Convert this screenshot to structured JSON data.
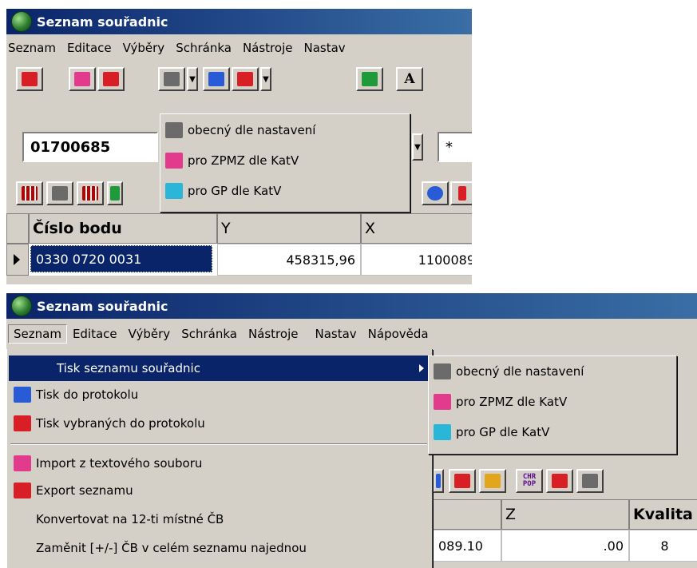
{
  "top": {
    "title": "Seznam souřadnic",
    "menu": [
      "Seznam",
      "Editace",
      "Výběry",
      "Schránka",
      "Nástroje",
      "Nastav"
    ],
    "point_field": "01700685",
    "filter_field": "*",
    "print_submenu": [
      "obecný dle nastavení",
      "pro ZPMZ dle KatV",
      "pro GP dle KatV"
    ],
    "toolbar_letter": "A",
    "grid": {
      "headers": [
        "Číslo bodu",
        "Y",
        "X"
      ],
      "row": {
        "cislo": "0330 0720 0031",
        "y": "458315,96",
        "x": "1100089"
      }
    }
  },
  "bottom": {
    "title": "Seznam souřadnic",
    "menu": [
      "Seznam",
      "Editace",
      "Výběry",
      "Schránka",
      "Nástroje",
      "Nastav",
      "Nápověda"
    ],
    "seznam_menu": [
      {
        "label": "Tisk seznamu souřadnic",
        "icon": "",
        "submenu": true
      },
      {
        "label": "Tisk do protokolu",
        "icon": "print-protocol-icon"
      },
      {
        "label": "Tisk vybraných do protokolu",
        "icon": "print-selected-icon"
      },
      {
        "label": "Import z textového souboru",
        "icon": "import-icon"
      },
      {
        "label": "Export seznamu",
        "icon": "export-icon"
      },
      {
        "label": "Konvertovat na 12-ti místné ČB",
        "icon": ""
      },
      {
        "label": "Zaměnit [+/-] ČB v celém seznamu najednou",
        "icon": ""
      }
    ],
    "print_submenu": [
      "obecný dle nastavení",
      "pro ZPMZ dle KatV",
      "pro GP dle KatV"
    ],
    "toolbar_chr": "CHR\nPOP",
    "grid": {
      "headers": [
        "Z",
        "Kvalita"
      ],
      "row": {
        "x_partial": "089.10",
        "z": ".00",
        "kvalita": "8"
      }
    }
  }
}
